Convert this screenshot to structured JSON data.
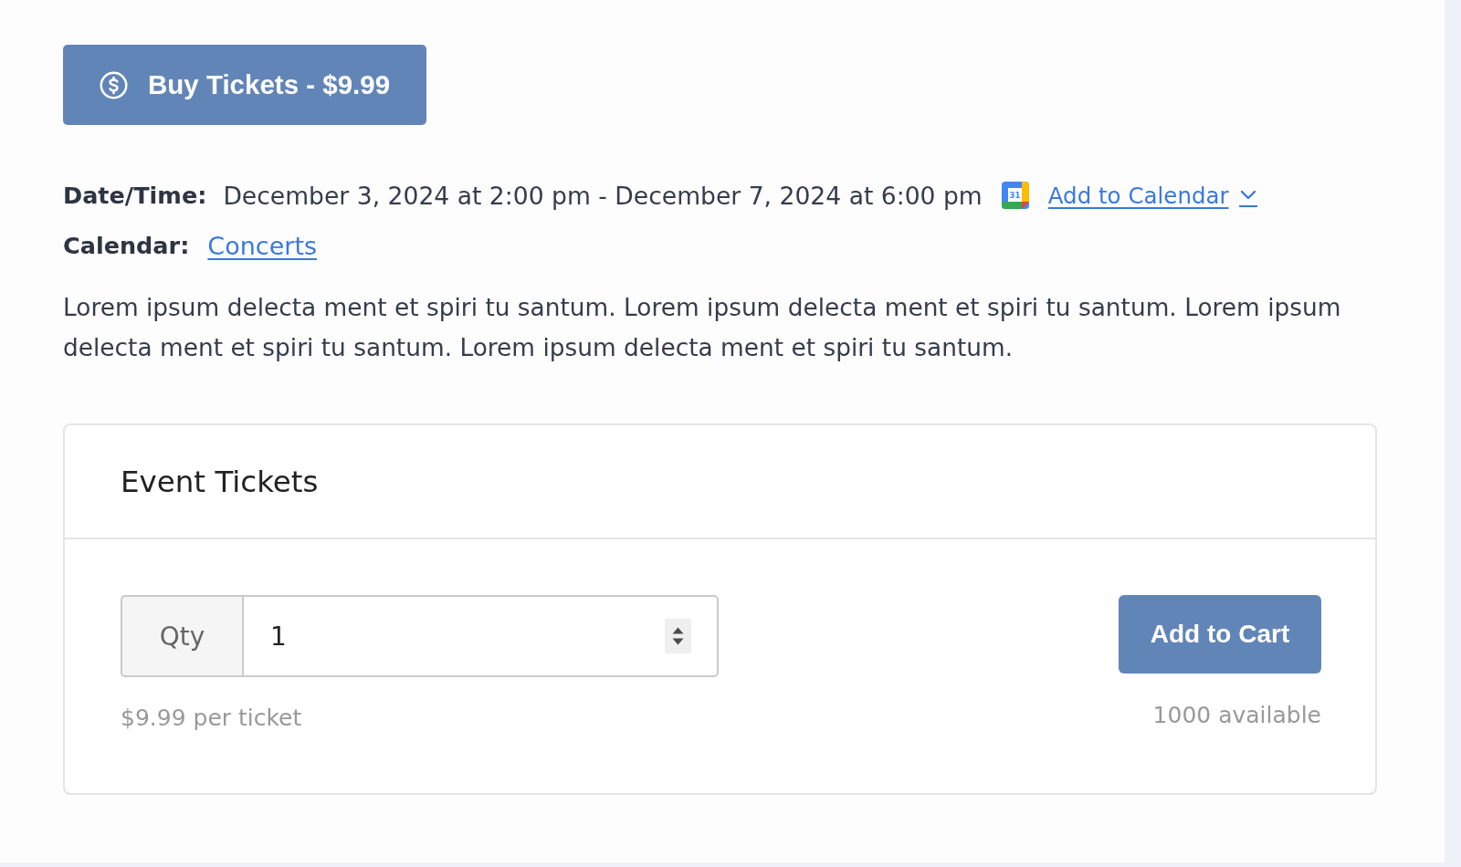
{
  "buy_button": {
    "label": "Buy Tickets - $9.99"
  },
  "details": [
    {
      "kind": "datetime",
      "label": "Date/Time:",
      "value": "December 3, 2024 at 2:00 pm - December 7, 2024 at 6:00 pm",
      "calendar_icon_text": "31",
      "action": "Add to Calendar"
    },
    {
      "kind": "link",
      "label": "Calendar:",
      "link": "Concerts"
    }
  ],
  "description": "Lorem ipsum delecta ment et spiri tu santum. Lorem ipsum delecta ment et spiri tu santum. Lorem ipsum delecta ment et spiri tu santum. Lorem ipsum delecta ment et spiri tu santum.",
  "tickets": {
    "title": "Event Tickets",
    "quantity_label": "Qty",
    "quantity": "1",
    "price_note": "$9.99 per ticket",
    "add_button": "Add to Cart",
    "availability": "1000 available"
  }
}
